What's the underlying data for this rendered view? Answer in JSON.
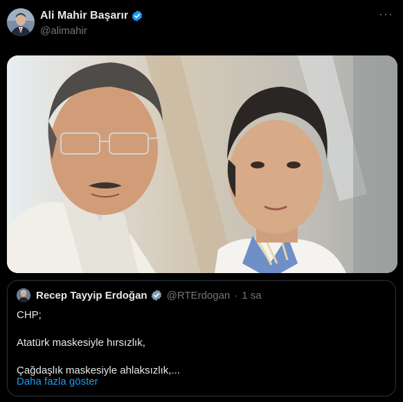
{
  "author": {
    "name": "Ali Mahir Başarır",
    "handle": "@alimahir"
  },
  "more_label": "···",
  "quoted": {
    "name": "Recep Tayyip Erdoğan",
    "handle": "@RTErdogan",
    "separator": "·",
    "time": "1 sa",
    "lines": [
      "CHP;",
      "Atatürk maskesiyle hırsızlık,",
      "Çağdaşlık maskesiyle ahlaksızlık,..."
    ],
    "show_more": "Daha fazla göster"
  },
  "colors": {
    "background": "#000000",
    "text": "#e7e9ea",
    "muted": "#71767b",
    "accent": "#1d9bf0",
    "border": "#2f3336"
  },
  "icons": {
    "verified": "verified-badge-icon",
    "more": "more-horizontal-icon"
  }
}
